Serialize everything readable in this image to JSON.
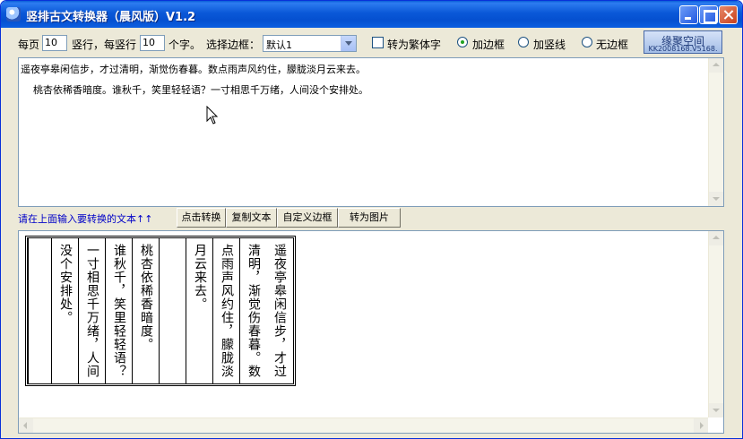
{
  "window": {
    "title": "竖排古文转换器（晨风版）V1.2"
  },
  "toolbar": {
    "per_page_label": "每页",
    "columns_per_page": "10",
    "cols_label": "竖行，每竖行",
    "chars_per_column": "10",
    "chars_label": "个字。",
    "border_label": "选择边框：",
    "border_value": "默认1",
    "traditional_label": "转为繁体字",
    "traditional_checked": false,
    "radio_border_label": "加边框",
    "radio_vline_label": "加竖线",
    "radio_none_label": "无边框",
    "selected_style": "border",
    "logo_main": "缘聚空间",
    "logo_sub": "KK2008168.V5168."
  },
  "input": {
    "line1": "遥夜亭皋闲信步，才过清明，渐觉伤春暮。数点雨声风约住，朦胧淡月云来去。",
    "line2": "    桃杏依稀香暗度。谁秋千，笑里轻轻语？一寸相思千万绪，人间没个安排处。"
  },
  "actions": {
    "hint": "请在上面输入要转换的文本↑↑",
    "convert": "点击转换",
    "copy": "复制文本",
    "custom_border": "自定义边框",
    "to_image": "转为图片"
  },
  "output": {
    "columns": [
      "遥夜亭皋闲信步，才过",
      "清明，渐觉伤春暮。数",
      "点雨声风约住，朦胧淡",
      "月云来去。",
      "",
      "桃杏依稀香暗度。",
      "谁秋千，笑里轻轻语？",
      "一寸相思千万绪，人间",
      "没个安排处。",
      ""
    ]
  },
  "icons": {
    "app": "app-icon",
    "cursor": "mouse-pointer-icon"
  }
}
